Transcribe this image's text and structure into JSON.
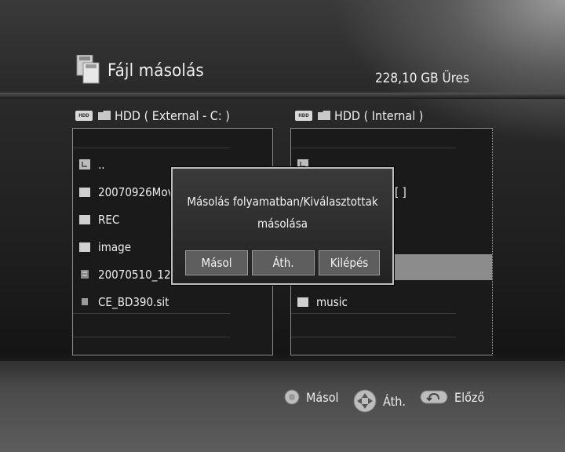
{
  "header": {
    "title": "Fájl másolás",
    "free_space": "228,10 GB Üres"
  },
  "left_panel": {
    "label": "HDD ( External - C: )",
    "items": [
      {
        "name": "..",
        "icon": "parent-folder-icon"
      },
      {
        "name": "20070926Movie",
        "icon": "folder-icon"
      },
      {
        "name": "REC",
        "icon": "folder-icon"
      },
      {
        "name": "image",
        "icon": "folder-icon"
      },
      {
        "name": "20070510_1226",
        "icon": "file-icon"
      },
      {
        "name": "CE_BD390.sit",
        "icon": "file-icon"
      }
    ]
  },
  "right_panel": {
    "label": "HDD ( Internal )",
    "items": [
      {
        "name": "..",
        "icon": "parent-folder-icon"
      },
      {
        "name": "[ ]",
        "icon": ""
      },
      {
        "name": "",
        "icon": ""
      },
      {
        "name": "",
        "icon": ""
      },
      {
        "name": "",
        "icon": ""
      },
      {
        "name": "music",
        "icon": "folder-icon"
      }
    ]
  },
  "dialog": {
    "message_line1": "Másolás folyamatban/Kiválasztottak",
    "message_line2": "másolása",
    "buttons": {
      "copy": "Másol",
      "move": "Áth.",
      "exit": "Kilépés"
    }
  },
  "footer": {
    "copy_label": "Másol",
    "move_label": "Áth.",
    "back_label": "Előző"
  },
  "colors": {
    "highlight": "#8c8c8c",
    "panel_border": "#8a8a8a",
    "dialog_border": "#bdbdbd"
  }
}
